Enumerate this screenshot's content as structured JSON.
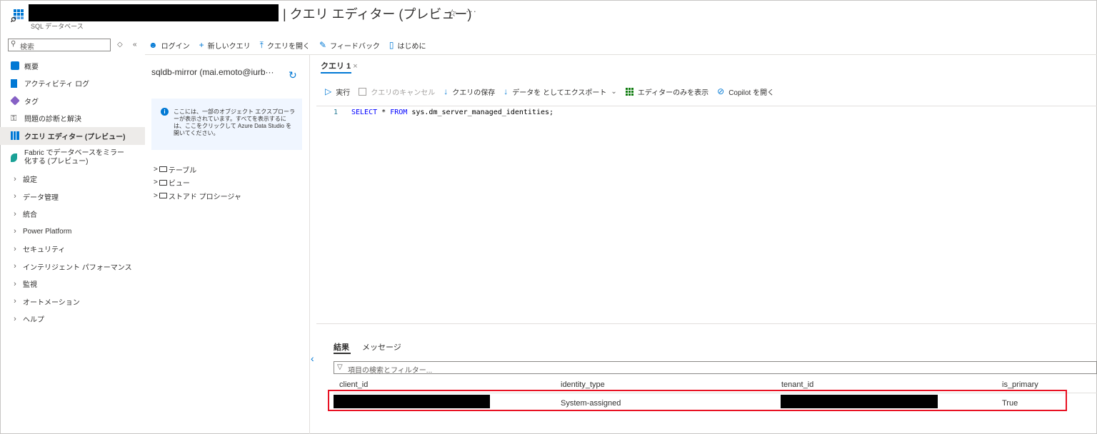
{
  "header": {
    "title": "| クエリ エディター (プレビュー)",
    "subtitle": "SQL データベース",
    "favorite_icon": "☆",
    "more_icon": "···"
  },
  "sidebar": {
    "search_placeholder": "検索",
    "items": [
      {
        "label": "概要",
        "icon": "sql-db-icon"
      },
      {
        "label": "アクティビティ ログ",
        "icon": "activity-log-icon"
      },
      {
        "label": "タグ",
        "icon": "tag-icon"
      },
      {
        "label": "問題の診断と解決",
        "icon": "wrench-icon"
      },
      {
        "label": "クエリ エディター (プレビュー)",
        "icon": "query-editor-icon",
        "active": true
      },
      {
        "label": "Fabric でデータベースをミラー化する (プレビュー)",
        "icon": "fabric-icon"
      },
      {
        "label": "設定",
        "expandable": true
      },
      {
        "label": "データ管理",
        "expandable": true
      },
      {
        "label": "統合",
        "expandable": true
      },
      {
        "label": "Power Platform",
        "expandable": true
      },
      {
        "label": "セキュリティ",
        "expandable": true
      },
      {
        "label": "インテリジェント パフォーマンス",
        "expandable": true
      },
      {
        "label": "監視",
        "expandable": true
      },
      {
        "label": "オートメーション",
        "expandable": true
      },
      {
        "label": "ヘルプ",
        "expandable": true
      }
    ]
  },
  "toolbar": {
    "login": "ログイン",
    "new_query": "新しいクエリ",
    "open_query": "クエリを開く",
    "feedback": "フィードバック",
    "getting_started": "はじめに"
  },
  "explorer": {
    "connection": "sqldb-mirror (mai.emoto@iurb···",
    "info_text": "ここには、一部のオブジェクト エクスプローラーが表示されています。すべてを表示するには、ここをクリックして Azure Data Studio を開いてください。",
    "tree": [
      "テーブル",
      "ビュー",
      "ストアド プロシージャ"
    ]
  },
  "query": {
    "tab_label": "クエリ 1",
    "tab_close": "×",
    "actions": {
      "run": "実行",
      "cancel": "クエリのキャンセル",
      "save": "クエリの保存",
      "export": "データを としてエクスポート",
      "editor_only": "エディターのみを表示",
      "copilot": "Copilot を開く"
    },
    "line_number": "1",
    "code": {
      "kw_select": "SELECT",
      "star": "*",
      "kw_from": "FROM",
      "table": "sys.dm_server_managed_identities;"
    }
  },
  "results": {
    "tab_results": "結果",
    "tab_messages": "メッセージ",
    "filter_placeholder": "項目の検索とフィルター...",
    "columns": [
      "client_id",
      "identity_type",
      "tenant_id",
      "is_primary"
    ],
    "row": {
      "client_id": "",
      "identity_type": "System-assigned",
      "tenant_id": "",
      "is_primary": "True"
    }
  },
  "colors": {
    "accent": "#0078d4",
    "highlight": "#e81123",
    "active_nav": "#edebe9"
  }
}
